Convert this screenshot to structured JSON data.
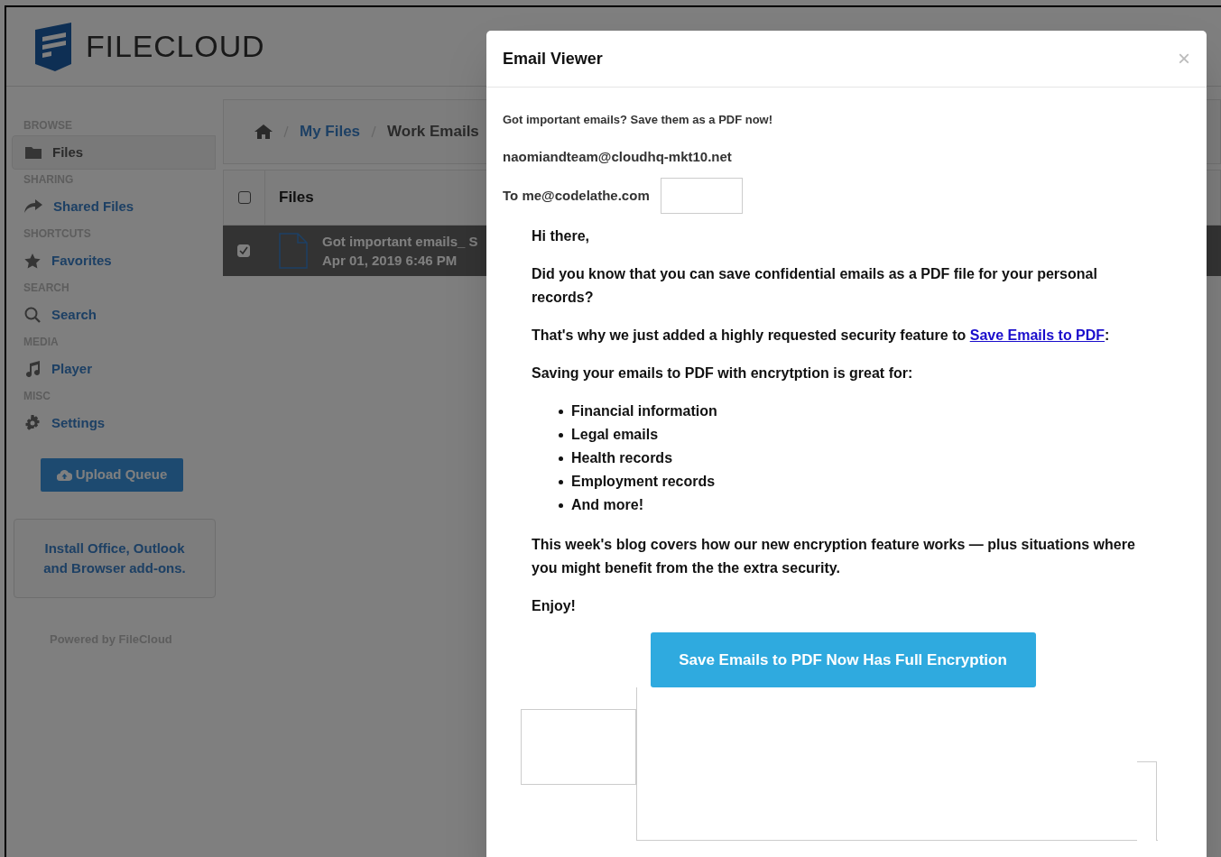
{
  "logo": {
    "text": "FILECLOUD"
  },
  "sidebar": {
    "items": [
      {
        "kind": "heading",
        "label": "BROWSE"
      },
      {
        "kind": "item",
        "label": "Files",
        "selected": true
      },
      {
        "kind": "heading",
        "label": "SHARING"
      },
      {
        "kind": "item",
        "label": "Shared Files",
        "selected": false
      },
      {
        "kind": "heading",
        "label": "SHORTCUTS"
      },
      {
        "kind": "item",
        "label": "Favorites",
        "selected": false
      },
      {
        "kind": "heading",
        "label": "SEARCH"
      },
      {
        "kind": "item",
        "label": "Search",
        "selected": false
      },
      {
        "kind": "heading",
        "label": "MEDIA"
      },
      {
        "kind": "item",
        "label": "Player",
        "selected": false
      },
      {
        "kind": "heading",
        "label": "MISC"
      },
      {
        "kind": "item",
        "label": "Settings",
        "selected": false
      }
    ],
    "upload_button": "Upload Queue",
    "addons_link": "Install Office, Outlook and Browser add-ons.",
    "footer": "Powered by FileCloud"
  },
  "breadcrumb": {
    "items": [
      "My Files",
      "Work Emails"
    ]
  },
  "file_table": {
    "header": {
      "label": "Files",
      "checked": false
    },
    "rows": [
      {
        "name": "Got important emails_ S",
        "date": "Apr 01, 2019 6:46 PM",
        "checked": true,
        "selected": true
      }
    ]
  },
  "email_viewer": {
    "title": "Email Viewer",
    "close": "×",
    "subject": "Got important emails? Save them as a PDF now!",
    "from": "naomiandteam@cloudhq-mkt10.net",
    "to": "To me@codelathe.com",
    "greeting": "Hi there,",
    "paragraphs": [
      {
        "text": "Did you know that you can save confidential emails as a PDF file for your personal records?"
      },
      {
        "text": "That's why we just added a highly requested security feature to ",
        "link": "Save Emails to PDF",
        "after": ":"
      },
      {
        "text": "Saving your emails to PDF with encrytption is great for:"
      }
    ],
    "bullets": [
      "Financial information",
      "Legal emails",
      "Health records",
      "Employment records",
      "And more!"
    ],
    "closing": "This week's blog covers how our new encryption feature works — plus situations where you might benefit from the the extra security.",
    "signoff": "Enjoy!",
    "cta_button": "Save Emails to PDF Now Has Full Encryption"
  }
}
